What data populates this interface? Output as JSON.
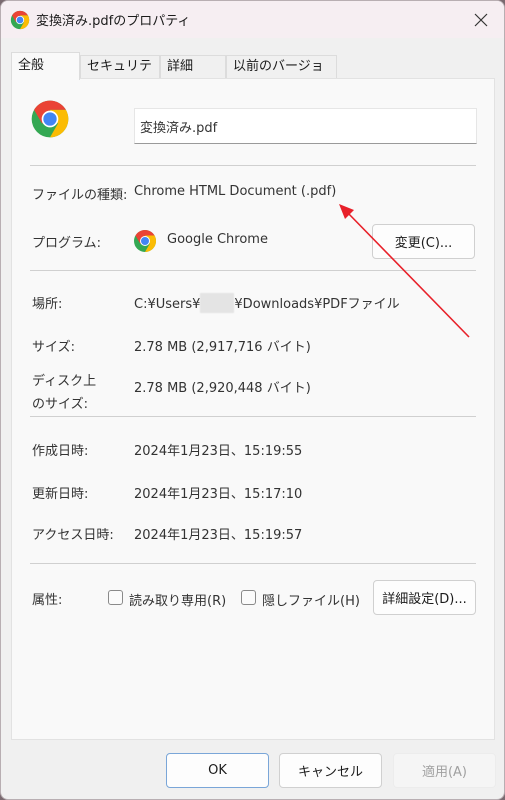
{
  "window": {
    "title": "変換済み.pdfのプロパティ",
    "close_icon": "close-icon"
  },
  "tabs": [
    {
      "label": "全般",
      "active": true
    },
    {
      "label": "セキュリティ",
      "active": false
    },
    {
      "label": "詳細",
      "active": false
    },
    {
      "label": "以前のバージョン",
      "active": false
    }
  ],
  "general": {
    "file_icon": "chrome-icon",
    "filename_value": "変換済み.pdf",
    "file_type_label": "ファイルの種類:",
    "file_type_value": "Chrome HTML Document (.pdf)",
    "program_label": "プログラム:",
    "program_icon": "chrome-icon",
    "program_value": "Google Chrome",
    "change_button": "変更(C)...",
    "location_label": "場所:",
    "location_prefix": "C:¥Users¥",
    "location_suffix": "¥Downloads¥PDFファイル",
    "size_label": "サイズ:",
    "size_value": "2.78 MB (2,917,716 バイト)",
    "disk_size_label_line1": "ディスク上",
    "disk_size_label_line2": "のサイズ:",
    "disk_size_value": "2.78 MB (2,920,448 バイト)",
    "created_label": "作成日時:",
    "created_value": "2024年1月23日、15:19:55",
    "modified_label": "更新日時:",
    "modified_value": "2024年1月23日、15:17:10",
    "accessed_label": "アクセス日時:",
    "accessed_value": "2024年1月23日、15:19:57",
    "attributes_label": "属性:",
    "readonly_label": "読み取り専用(R)",
    "readonly_checked": false,
    "hidden_label": "隠しファイル(H)",
    "hidden_checked": false,
    "advanced_button": "詳細設定(D)..."
  },
  "footer": {
    "ok": "OK",
    "cancel": "キャンセル",
    "apply": "適用(A)",
    "apply_enabled": false
  },
  "annotation": {
    "arrow_color": "#e8212a"
  }
}
